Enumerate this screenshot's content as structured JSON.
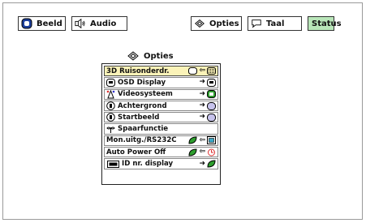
{
  "tabs": [
    {
      "label": "Beeld",
      "icon": "picture-icon"
    },
    {
      "label": "Audio",
      "icon": "speaker-icon"
    },
    {
      "label": "Opties",
      "icon": "options-icon"
    },
    {
      "label": "Taal",
      "icon": "speech-bubble-icon"
    },
    {
      "label": "Status",
      "active": true
    }
  ],
  "menu": {
    "title": "Opties",
    "items": [
      {
        "label": "3D Ruisonderdr.",
        "arrow": "⇦"
      },
      {
        "label": "OSD Display",
        "arrow": "➜"
      },
      {
        "label": "Videosysteem",
        "arrow": "➜"
      },
      {
        "label": "Achtergrond",
        "arrow": "➜"
      },
      {
        "label": "Startbeeld",
        "arrow": "➜"
      },
      {
        "label": "Spaarfunctie"
      },
      {
        "label": "Mon.uitg./RS232C",
        "arrow": "⇦"
      },
      {
        "label": "Auto Power Off",
        "arrow": "⇦"
      },
      {
        "label": "ID nr. display",
        "arrow": "➜"
      }
    ]
  },
  "colors": {
    "selected_row": "#fbf3b8",
    "status_tab": "#b9e6b9",
    "green_icon": "#2e9e2e"
  }
}
